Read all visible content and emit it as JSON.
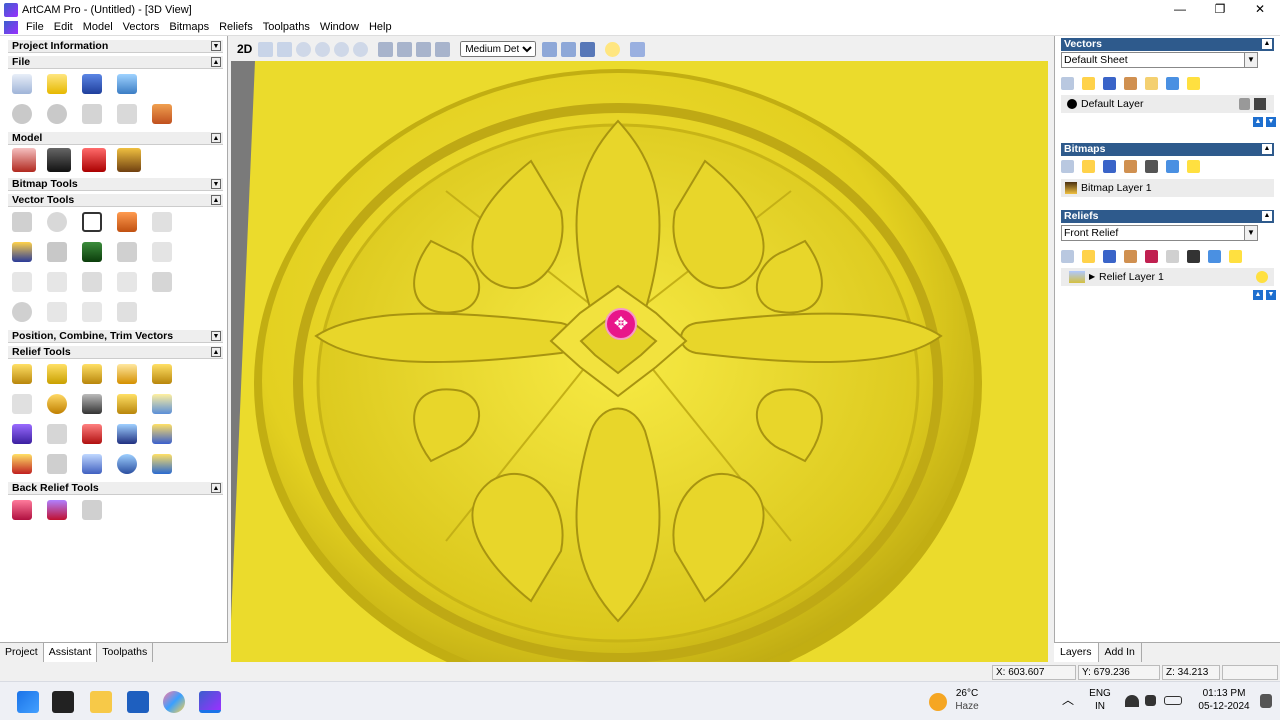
{
  "window": {
    "title": "ArtCAM Pro - (Untitled) - [3D View]",
    "minimize": "—",
    "maximize": "❐",
    "close": "✕"
  },
  "menu": [
    "File",
    "Edit",
    "Model",
    "Vectors",
    "Bitmaps",
    "Reliefs",
    "Toolpaths",
    "Window",
    "Help"
  ],
  "left": {
    "sections": {
      "project_info": "Project Information",
      "file": "File",
      "model": "Model",
      "bitmap_tools": "Bitmap Tools",
      "vector_tools": "Vector Tools",
      "position": "Position, Combine, Trim Vectors",
      "relief_tools": "Relief Tools",
      "back_relief": "Back Relief Tools"
    },
    "collapse_glyph": "▼",
    "expand_glyph": "▲",
    "tabs": [
      "Project",
      "Assistant",
      "Toolpaths"
    ]
  },
  "view": {
    "mode_2d": "2D",
    "detail": "Medium Detail"
  },
  "status": {
    "x": "X: 603.607",
    "y": "Y: 679.236",
    "z": "Z: 34.213"
  },
  "right": {
    "vectors": {
      "title": "Vectors",
      "sheet": "Default Sheet",
      "layer": "Default Layer"
    },
    "bitmaps": {
      "title": "Bitmaps",
      "layer": "Bitmap Layer 1"
    },
    "reliefs": {
      "title": "Reliefs",
      "sheet": "Front Relief",
      "layer": "Relief Layer 1"
    },
    "tabs": [
      "Layers",
      "Add In"
    ],
    "dd": "▼",
    "up": "▲",
    "down": "▼"
  },
  "taskbar": {
    "weather_temp": "26°C",
    "weather_text": "Haze",
    "lang1": "ENG",
    "lang2": "IN",
    "time": "01:13 PM",
    "date": "05-12-2024",
    "chevron": "︿"
  },
  "colors": {
    "relief": "#e6d21c",
    "panel_header": "#2e5a8c",
    "cursor_marker": "#e8168a"
  }
}
